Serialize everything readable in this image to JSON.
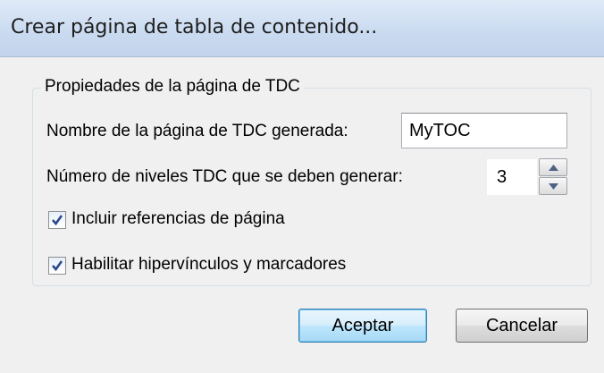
{
  "window": {
    "title": "Crear página de tabla de contenido..."
  },
  "group": {
    "legend": "Propiedades de la página de TDC"
  },
  "fields": {
    "name_label": "Nombre de la página de TDC generada:",
    "name_value": "MyTOC",
    "levels_label": "Número de niveles TDC que se deben generar:",
    "levels_value": "3"
  },
  "options": {
    "page_refs": {
      "label": "Incluir referencias de página",
      "checked": true
    },
    "hyperlinks": {
      "label": "Habilitar hipervínculos y marcadores",
      "checked": true
    }
  },
  "buttons": {
    "ok": "Aceptar",
    "cancel": "Cancelar"
  }
}
